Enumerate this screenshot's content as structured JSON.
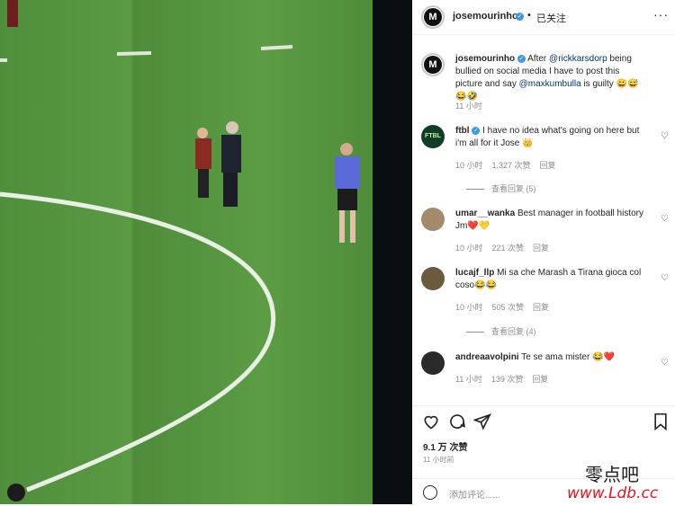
{
  "post": {
    "author": "josemourinho",
    "avatar_letter": "M",
    "separator": "•",
    "follow_status": "已关注",
    "more": "···",
    "caption_before": "After ",
    "caption_mention1": "@rickkarsdorp",
    "caption_middle": " being bullied on social media I have to post this picture and say ",
    "caption_mention2": "@maxkumbulla",
    "caption_after": " is guilty 😀😅😂🤣",
    "caption_time": "11 小时"
  },
  "comments": [
    {
      "user": "ftbl",
      "verified": true,
      "text": "I have no idea what's going on here but i'm all for it Jose 👑",
      "time": "10 小时",
      "likes": "1,327 次赞",
      "reply": "回复",
      "view_replies": "查看回复 (5)",
      "avatar_color": "#0f3d27",
      "avatar_text": "FTBL"
    },
    {
      "user": "umar__wanka",
      "verified": false,
      "text": "Best manager in football history Jm❤️💛",
      "time": "10 小时",
      "likes": "221 次赞",
      "reply": "回复",
      "avatar_color": "#a48a6a"
    },
    {
      "user": "lucajf_llp",
      "verified": false,
      "text": "Mi sa che Marash a Tirana gioca col coso😂😂",
      "time": "10 小时",
      "likes": "505 次赞",
      "reply": "回复",
      "view_replies": "查看回复 (4)",
      "avatar_color": "#6b5a3e"
    },
    {
      "user": "andreaavolpini",
      "verified": false,
      "text": "Te se ama mister 😂❤️",
      "time": "11 小时",
      "likes": "139 次赞",
      "reply": "回复",
      "avatar_color": "#2a2a2a"
    }
  ],
  "actions": {
    "like_icon": "heart-icon",
    "comment_icon": "comment-icon",
    "share_icon": "send-icon",
    "save_icon": "bookmark-icon",
    "likes_count": "9.1 万 次赞",
    "posted_time": "11 小时前",
    "add_comment_placeholder": "添加评论......"
  },
  "watermark": {
    "line1": "零点吧",
    "line2": "www.Ldb.cc"
  }
}
